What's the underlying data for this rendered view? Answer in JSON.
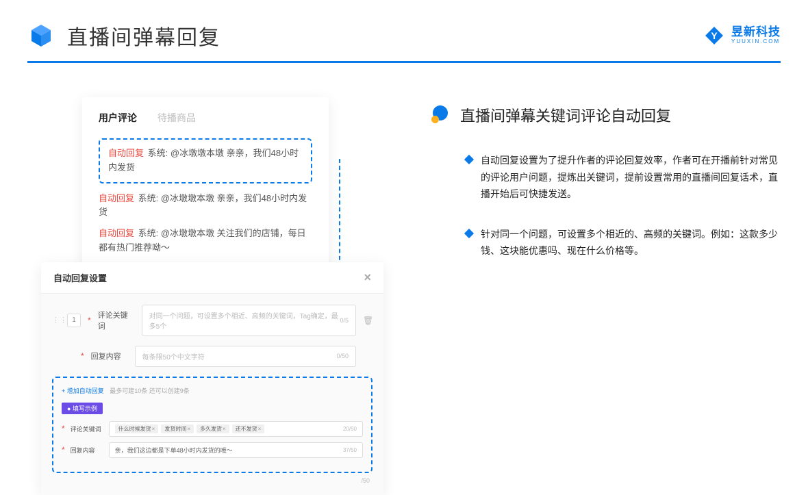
{
  "header": {
    "title": "直播间弹幕回复",
    "brand_cn": "昱新科技",
    "brand_en": "YUUXIN.COM"
  },
  "top_card": {
    "tab_active": "用户评论",
    "tab_inactive": "待播商品",
    "auto_tag": "自动回复",
    "line1_rest": " 系统: @冰墩墩本墩 亲亲，我们48小时内发货",
    "line2_rest": " 系统: @冰墩墩本墩 亲亲，我们48小时内发货",
    "line3_rest": " 系统: @冰墩墩本墩 关注我们的店铺，每日都有热门推荐呦～"
  },
  "modal": {
    "title": "自动回复设置",
    "index": "1",
    "label1": "评论关键词",
    "placeholder1": "对同一个问题，可设置多个相近、高频的关键词，Tag确定，最多5个",
    "counter1": "0/5",
    "label2": "回复内容",
    "placeholder2": "每条限50个中文字符",
    "counter2": "0/50",
    "hint_add": "+ 增加自动回复",
    "hint_gray": "最多可建10条 还可以创建9条",
    "example_badge": "● 填写示例",
    "ex_label1": "评论关键词",
    "chips": [
      "什么时候发货",
      "发货时间",
      "多久发货",
      "还不发货"
    ],
    "ex_counter1": "20/50",
    "ex_label2": "回复内容",
    "ex_text": "亲，我们这边都是下单48小时内发货的哦～",
    "ex_counter2": "37/50",
    "lower_counter": "/50"
  },
  "right": {
    "section_title": "直播间弹幕关键词评论自动回复",
    "bullet1": "自动回复设置为了提升作者的评论回复效率，作者可在开播前针对常见的评论用户问题，提炼出关键词，提前设置常用的直播间回复话术，直播开始后可快捷发送。",
    "bullet2": "针对同一个问题，可设置多个相近的、高频的关键词。例如：这款多少钱、这块能优惠吗、现在什么价格等。"
  }
}
